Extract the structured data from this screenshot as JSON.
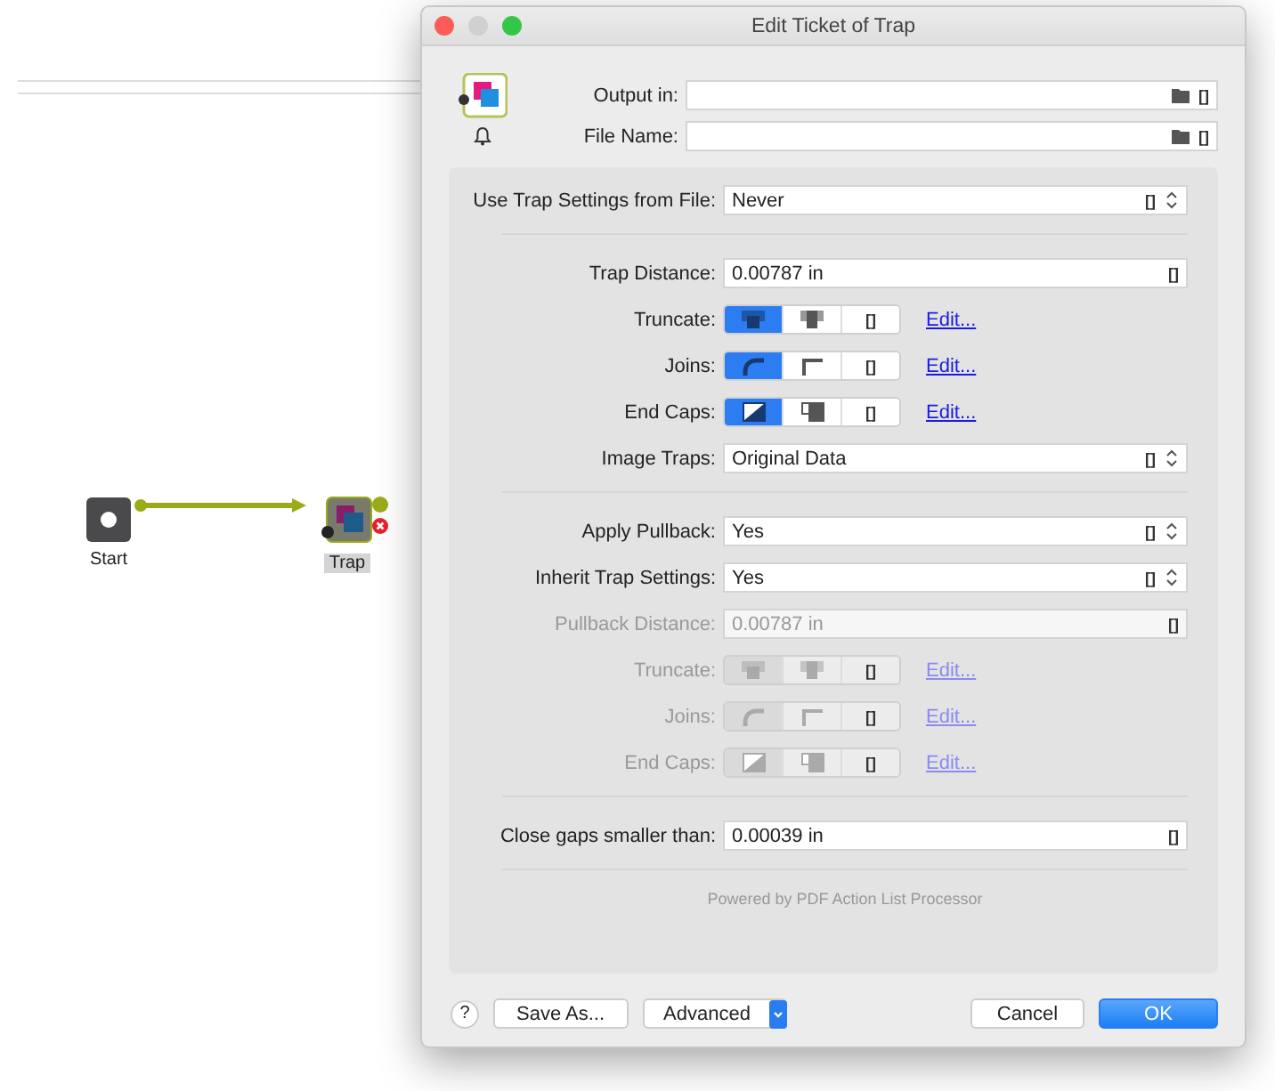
{
  "canvas": {
    "nodes": [
      {
        "kind": "start",
        "label": "Start",
        "selected": false
      },
      {
        "kind": "trap",
        "label": "Trap",
        "selected": true
      }
    ]
  },
  "dialog": {
    "title": "Edit Ticket of Trap",
    "outputs": [
      {
        "label": "Output in:",
        "folder": "[]"
      },
      {
        "label": "File Name:",
        "folder": "[]"
      }
    ],
    "sections": [
      {
        "rows": [
          {
            "kind": "popup",
            "label": "Use Trap Settings from File:",
            "value": "Never",
            "mark": "[]",
            "disabled": false
          }
        ]
      },
      {
        "rows": [
          {
            "kind": "field",
            "label": "Trap Distance:",
            "value": "0.00787 in",
            "mark": "[]",
            "disabled": false
          },
          {
            "kind": "segmented",
            "label": "Truncate:",
            "disabled": false,
            "link": "Edit...",
            "segments": [
              {
                "kind": "overlap",
                "selected": true
              },
              {
                "kind": "stacked",
                "selected": false
              },
              {
                "kind": "text",
                "text": "[]",
                "selected": false
              }
            ]
          },
          {
            "kind": "segmented",
            "label": "Joins:",
            "disabled": false,
            "link": "Edit...",
            "segments": [
              {
                "kind": "round-join",
                "selected": true
              },
              {
                "kind": "miter-join",
                "selected": false
              },
              {
                "kind": "text",
                "text": "[]",
                "selected": false
              }
            ]
          },
          {
            "kind": "segmented",
            "label": "End Caps:",
            "disabled": false,
            "link": "Edit...",
            "segments": [
              {
                "kind": "diagonal-cap",
                "selected": true
              },
              {
                "kind": "square-cap",
                "selected": false
              },
              {
                "kind": "text",
                "text": "[]",
                "selected": false
              }
            ]
          },
          {
            "kind": "popup",
            "label": "Image Traps:",
            "value": "Original Data",
            "mark": "[]",
            "disabled": false
          }
        ]
      },
      {
        "rows": [
          {
            "kind": "popup",
            "label": "Apply Pullback:",
            "value": "Yes",
            "mark": "[]",
            "disabled": false
          },
          {
            "kind": "popup",
            "label": "Inherit Trap Settings:",
            "value": "Yes",
            "mark": "[]",
            "disabled": false
          },
          {
            "kind": "field",
            "label": "Pullback Distance:",
            "value": "0.00787 in",
            "mark": "[]",
            "disabled": true
          },
          {
            "kind": "segmented",
            "label": "Truncate:",
            "disabled": true,
            "link": "Edit...",
            "segments": [
              {
                "kind": "overlap",
                "selected": true
              },
              {
                "kind": "stacked",
                "selected": false
              },
              {
                "kind": "text",
                "text": "[]",
                "selected": false
              }
            ]
          },
          {
            "kind": "segmented",
            "label": "Joins:",
            "disabled": true,
            "link": "Edit...",
            "segments": [
              {
                "kind": "round-join",
                "selected": true
              },
              {
                "kind": "miter-join",
                "selected": false
              },
              {
                "kind": "text",
                "text": "[]",
                "selected": false
              }
            ]
          },
          {
            "kind": "segmented",
            "label": "End Caps:",
            "disabled": true,
            "link": "Edit...",
            "segments": [
              {
                "kind": "diagonal-cap",
                "selected": true
              },
              {
                "kind": "square-cap",
                "selected": false
              },
              {
                "kind": "text",
                "text": "[]",
                "selected": false
              }
            ]
          }
        ]
      },
      {
        "rows": [
          {
            "kind": "field",
            "label": "Close gaps smaller than:",
            "value": "0.00039 in",
            "mark": "[]",
            "disabled": false
          }
        ]
      }
    ],
    "footer": "Powered by PDF Action List Processor",
    "help": "?",
    "buttons": [
      {
        "kind": "plain",
        "label": "Save As..."
      },
      {
        "kind": "menu",
        "label": "Advanced"
      },
      {
        "kind": "plain",
        "label": "Cancel"
      },
      {
        "kind": "default",
        "label": "OK"
      }
    ]
  }
}
